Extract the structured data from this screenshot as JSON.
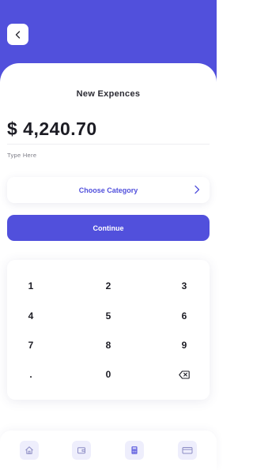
{
  "header": {
    "back_icon": "chevron-left-icon"
  },
  "title": "New Expences",
  "amount": "$ 4,240.70",
  "hint": "Type Here",
  "category": {
    "label": "Choose Category",
    "icon": "chevron-right-icon"
  },
  "continue_label": "Continue",
  "keypad": {
    "rows": [
      [
        "1",
        "2",
        "3"
      ],
      [
        "4",
        "5",
        "6"
      ],
      [
        "7",
        "8",
        "9"
      ],
      [
        ".",
        "0",
        "backspace-icon"
      ]
    ]
  },
  "nav": {
    "items": [
      {
        "icon": "home-icon"
      },
      {
        "icon": "wallet-icon"
      },
      {
        "icon": "calculator-icon",
        "active": true
      },
      {
        "icon": "credit-card-icon"
      }
    ]
  },
  "colors": {
    "accent": "#5150dc",
    "nav_bg": "#eeeefc"
  }
}
